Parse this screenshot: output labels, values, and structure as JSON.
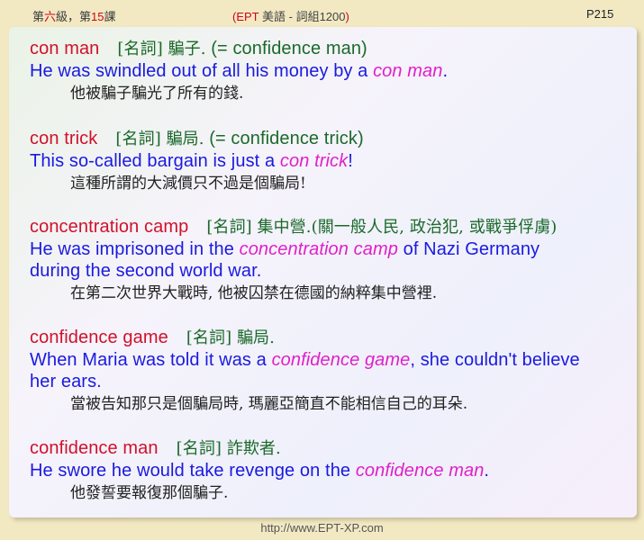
{
  "header": {
    "lesson_prefix": "第",
    "level": "六",
    "lesson_mid": "級，第",
    "lesson_num": "15",
    "lesson_suffix": "課",
    "paren_open": "(",
    "brand": "EPT",
    "series_rest": " 美語 - 詞組1200",
    "paren_close": ")",
    "page": "P215"
  },
  "entries": [
    {
      "term": "con man",
      "pos": "[名詞]",
      "definition": "騙子.",
      "note": "(= confidence man)",
      "sentence": [
        "He was swindled out of all his money by a ",
        "con man",
        "."
      ],
      "translation": "他被騙子騙光了所有的錢."
    },
    {
      "term": "con trick",
      "pos": "[名詞]",
      "definition": "騙局.",
      "note": "(= confidence trick)",
      "sentence": [
        "This so-called bargain is just a ",
        "con trick",
        "!"
      ],
      "translation": "這種所謂的大減價只不過是個騙局!"
    },
    {
      "term": "concentration camp",
      "pos": "[名詞]",
      "definition": "集中營.(關一般人民, 政治犯, 或戰爭俘虜)",
      "note": "",
      "sentence": [
        "He was imprisoned in the ",
        "concentration camp",
        " of Nazi Germany"
      ],
      "sentence2": "during the second world war.",
      "translation": "在第二次世界大戰時, 他被囚禁在德國的納粹集中營裡."
    },
    {
      "term": "confidence game",
      "pos": "[名詞]",
      "definition": "騙局.",
      "note": "",
      "sentence": [
        "When Maria was told it was a ",
        "confidence game",
        ", she couldn't believe"
      ],
      "sentence2": "her ears.",
      "translation": "當被告知那只是個騙局時, 瑪麗亞簡直不能相信自己的耳朵."
    },
    {
      "term": "confidence man",
      "pos": "[名詞]",
      "definition": "詐欺者.",
      "note": "",
      "sentence": [
        "He swore he would take revenge on the ",
        "confidence man",
        "."
      ],
      "translation": "他發誓要報復那個騙子."
    }
  ],
  "footer": {
    "url": "http://www.EPT-XP.com"
  },
  "colors": {
    "term": "#d0112b",
    "sentence": "#1a1ae0",
    "highlight": "#e020c8",
    "part_of_speech": "#1a6a2a",
    "background": "#f2e9c3"
  }
}
